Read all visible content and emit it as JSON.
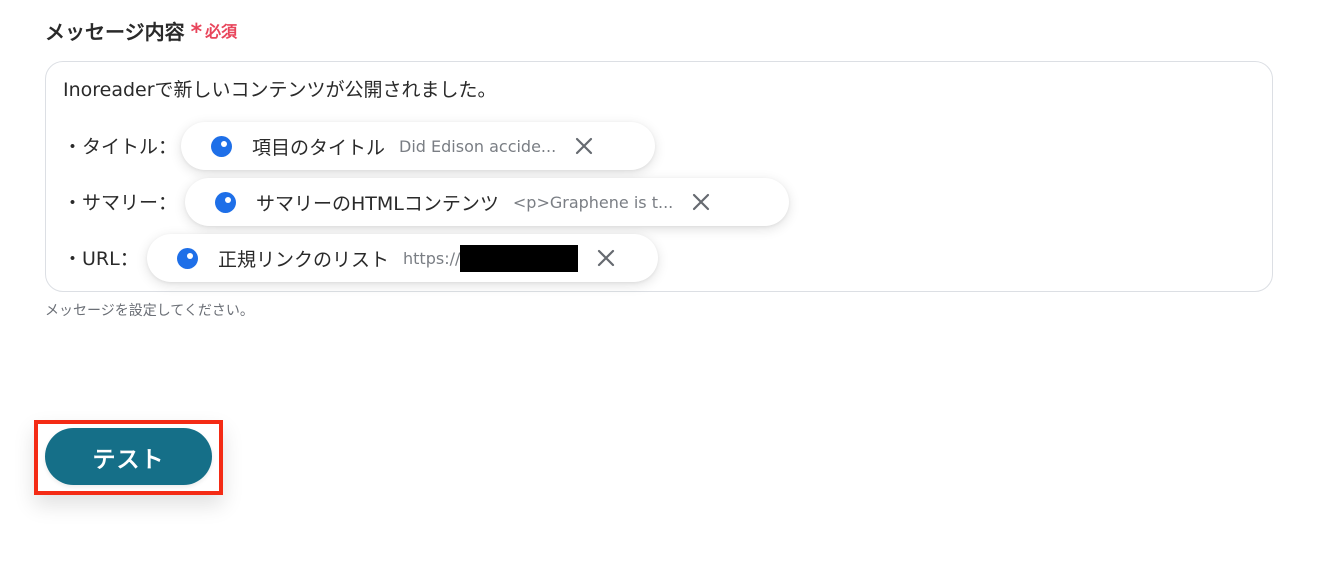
{
  "field": {
    "label": "メッセージ内容",
    "required_mark": "*",
    "required_text": "必須",
    "helper": "メッセージを設定してください。"
  },
  "message": {
    "intro": "Inoreaderで新しいコンテンツが公開されました。",
    "lines": [
      {
        "prefix": "・タイトル：",
        "chip_name": "項目のタイトル",
        "chip_value": "Did Edison accide..."
      },
      {
        "prefix": "・サマリー：",
        "chip_name": "サマリーのHTMLコンテンツ",
        "chip_value": "<p>Graphene is t..."
      },
      {
        "prefix": "・URL：",
        "chip_name": "正規リンクのリスト",
        "chip_value": "https://"
      }
    ]
  },
  "actions": {
    "test_label": "テスト"
  },
  "colors": {
    "accent": "#156f88",
    "required": "#e8455b",
    "chip_dot": "#1e6fe8",
    "highlight": "#f42b15"
  },
  "icons": {
    "chip_dot": "variable-dot-icon",
    "remove": "close-icon"
  }
}
